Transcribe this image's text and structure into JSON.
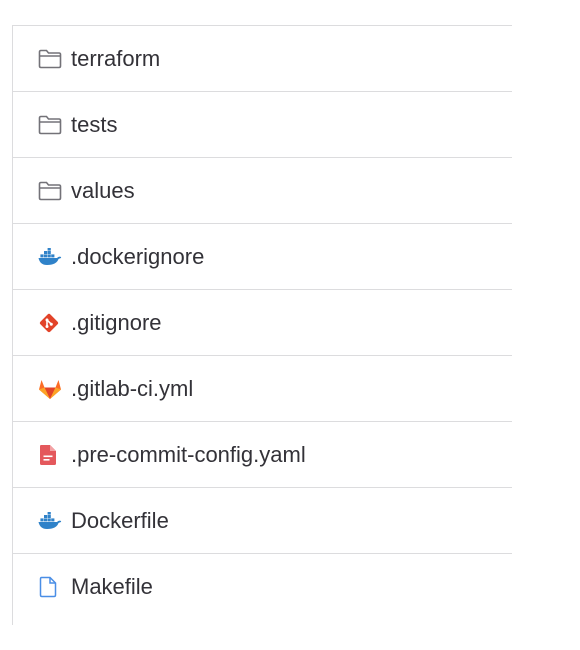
{
  "files": [
    {
      "name": "terraform",
      "icon": "folder-icon"
    },
    {
      "name": "tests",
      "icon": "folder-icon"
    },
    {
      "name": "values",
      "icon": "folder-icon"
    },
    {
      "name": ".dockerignore",
      "icon": "docker-icon"
    },
    {
      "name": ".gitignore",
      "icon": "git-icon"
    },
    {
      "name": ".gitlab-ci.yml",
      "icon": "gitlab-icon"
    },
    {
      "name": ".pre-commit-config.yaml",
      "icon": "yaml-file-icon"
    },
    {
      "name": "Dockerfile",
      "icon": "docker-icon"
    },
    {
      "name": "Makefile",
      "icon": "file-icon"
    }
  ],
  "colors": {
    "text": "#333238",
    "border": "#dcdcde",
    "folder": "#737278",
    "docker": "#2f82c9",
    "git": "#e24329",
    "gitlab_primary": "#fc6d26",
    "gitlab_secondary": "#e24329",
    "yaml": "#e4585c",
    "file": "#4a8ee6"
  }
}
